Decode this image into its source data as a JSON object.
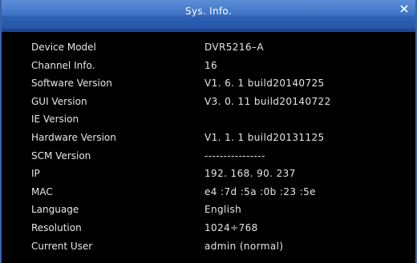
{
  "window": {
    "title": "Sys. Info.",
    "close_icon": "close-icon"
  },
  "info": [
    {
      "label": "Device Model",
      "value": "DVR5216–A"
    },
    {
      "label": "Channel Info.",
      "value": "16"
    },
    {
      "label": "Software Version",
      "value": "V1. 6. 1  build20140725"
    },
    {
      "label": "GUI Version",
      "value": "V3. 0. 11  build20140722"
    },
    {
      "label": "IE Version",
      "value": ""
    },
    {
      "label": "Hardware Version",
      "value": "V1. 1. 1  build20131125"
    },
    {
      "label": "SCM Version",
      "value": "----------------"
    },
    {
      "label": "IP",
      "value": "192. 168. 90. 237"
    },
    {
      "label": "MAC",
      "value": "e4 :7d :5a :0b :23 :5e"
    },
    {
      "label": "Language",
      "value": "English"
    },
    {
      "label": "Resolution",
      "value": "1024÷768"
    },
    {
      "label": "Current User",
      "value": "admin (normal)"
    }
  ],
  "colors": {
    "titlebar": "#3f73c4",
    "background": "#000000",
    "text": "#e6e6e6"
  }
}
